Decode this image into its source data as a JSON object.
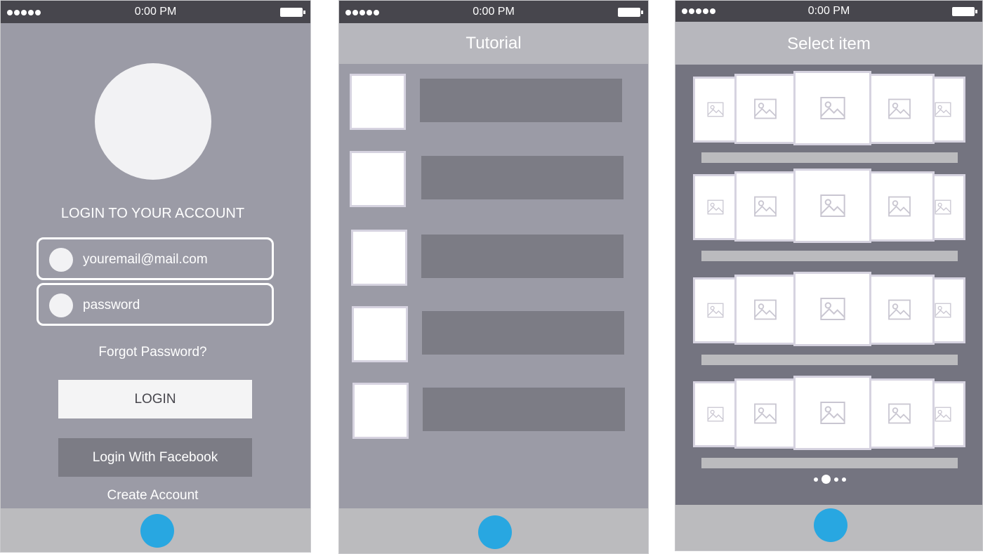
{
  "status_bar": {
    "time": "0:00 PM"
  },
  "login_screen": {
    "heading": "LOGIN TO YOUR ACCOUNT",
    "email_placeholder": "youremail@mail.com",
    "password_placeholder": "password",
    "forgot_password": "Forgot Password?",
    "login_button": "LOGIN",
    "facebook_button": "Login With Facebook",
    "create_account": "Create Account"
  },
  "tutorial_screen": {
    "title": "Tutorial",
    "item_count": 5
  },
  "select_screen": {
    "title": "Select item",
    "carousel_rows": 4,
    "pager": {
      "pages": 4,
      "active_index": 1
    }
  },
  "icons": {
    "signal": "signal-dots-icon",
    "battery": "battery-icon",
    "home": "home-button",
    "placeholder": "image-placeholder-icon"
  },
  "colors": {
    "status_bar": "#47464d",
    "screen_bg": "#9b9ba6",
    "nav_bar": "#b7b7bd",
    "home_button": "#28a7e1",
    "carousel_bg": "#747480"
  }
}
